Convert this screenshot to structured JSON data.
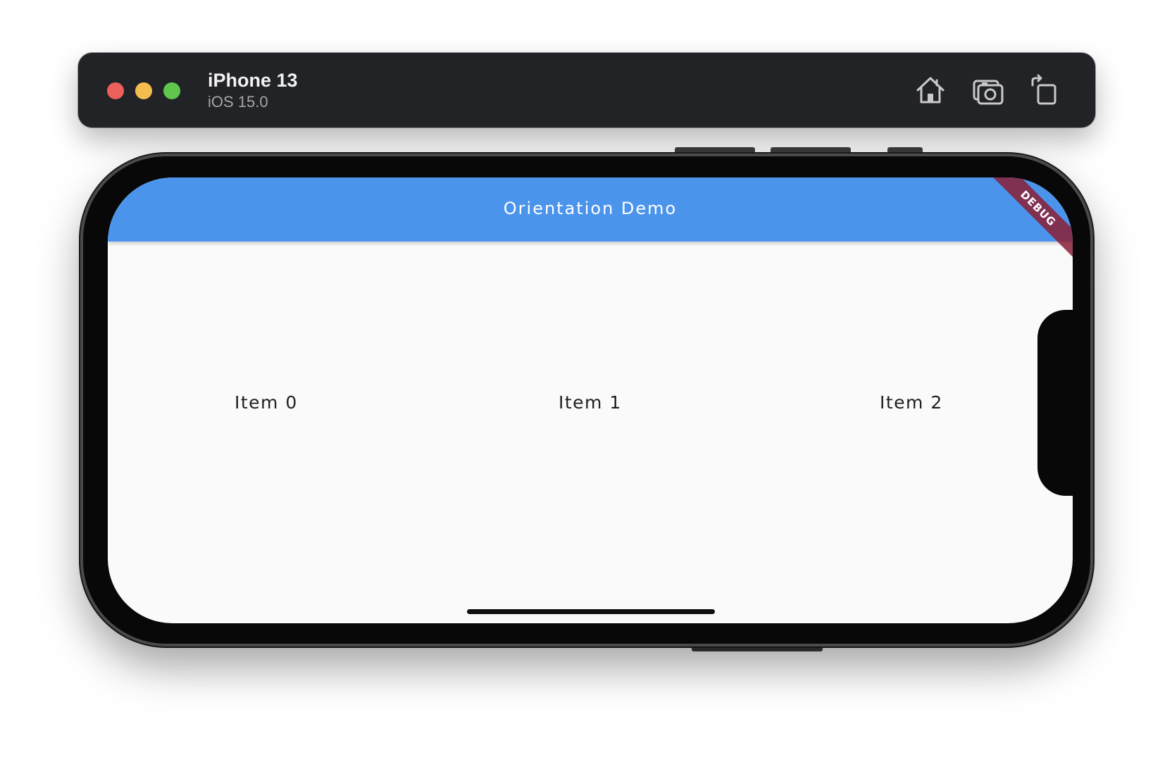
{
  "simulator": {
    "device_name": "iPhone 13",
    "os_version": "iOS 15.0",
    "controls": [
      "home-icon",
      "screenshot-icon",
      "rotate-icon"
    ]
  },
  "app": {
    "title": "Orientation Demo",
    "debug_banner": "DEBUG",
    "items": [
      "Item 0",
      "Item 1",
      "Item 2"
    ]
  },
  "colors": {
    "appbar": "#4a94ec",
    "debug_ribbon": "#8a2037",
    "titlebar": "#222326"
  }
}
